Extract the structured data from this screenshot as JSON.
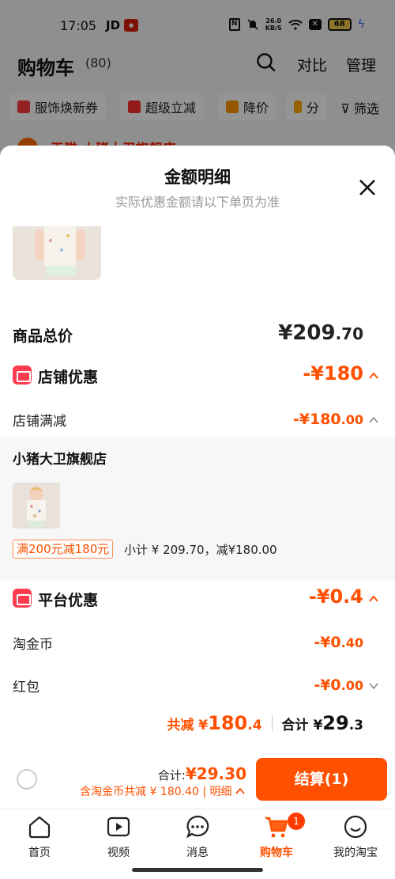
{
  "status_bar": {
    "time": "17:05",
    "carrier_app": "JD",
    "speed_value": "26.0",
    "speed_unit": "KB/S",
    "battery": "68"
  },
  "cart_header": {
    "title": "购物车",
    "count": "(80)",
    "compare": "对比",
    "manage": "管理"
  },
  "filters": {
    "chips": [
      "服饰焕新券",
      "超级立减",
      "降价",
      "分"
    ],
    "filter": "筛选"
  },
  "store_peek": {
    "name": "天猫 小猪大卫旗舰店"
  },
  "sheet": {
    "title": "金额明细",
    "subtitle": "实际优惠金额请以下单页为准",
    "total_label": "商品总价",
    "total_value_main": "¥209",
    "total_value_dec": ".70",
    "store_discount_label": "店铺优惠",
    "store_discount_value": "-¥180",
    "store_full_reduction_label": "店铺满减",
    "store_full_reduction_main": "-¥180",
    "store_full_reduction_dec": ".00",
    "store_name": "小猪大卫旗舰店",
    "promo_tag": "满200元减180元",
    "subtotal": "小计 ¥ 209.70，减¥180.00",
    "platform_label": "平台优惠",
    "platform_value": "-¥0.4",
    "coin_label": "淘金币",
    "coin_main": "-¥0",
    "coin_dec": ".40",
    "redpacket_label": "红包",
    "redpacket_main": "-¥0",
    "redpacket_dec": ".00",
    "summary_reduce_prefix": "共减 ¥",
    "summary_reduce_main": "180",
    "summary_reduce_dec": ".4",
    "summary_total_prefix": "合计 ¥",
    "summary_total_main": "29",
    "summary_total_dec": ".3"
  },
  "action_bar": {
    "total_label": "合计:",
    "total_value": "¥29.30",
    "detail": "含淘金币共减 ¥ 180.40 | 明细",
    "checkout": "结算(1)"
  },
  "nav": {
    "items": [
      {
        "label": "首页",
        "icon": "home-icon"
      },
      {
        "label": "视频",
        "icon": "video-icon"
      },
      {
        "label": "消息",
        "icon": "message-icon"
      },
      {
        "label": "购物车",
        "icon": "cart-icon",
        "badge": "1"
      },
      {
        "label": "我的淘宝",
        "icon": "profile-icon"
      }
    ]
  },
  "colors": {
    "accent": "#ff5000",
    "red_icon": "#ff3b50"
  }
}
